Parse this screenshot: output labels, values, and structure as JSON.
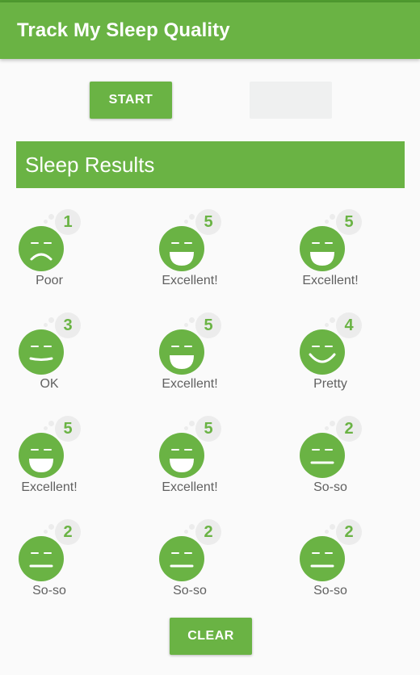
{
  "app": {
    "title": "Track My Sleep Quality"
  },
  "controls": {
    "start_label": "START",
    "stop_label": "",
    "clear_label": "CLEAR"
  },
  "results": {
    "title": "Sleep Results",
    "items": [
      {
        "rating": "1",
        "label": "Poor",
        "face": "sad"
      },
      {
        "rating": "5",
        "label": "Excellent!",
        "face": "laugh"
      },
      {
        "rating": "5",
        "label": "Excellent!",
        "face": "laugh"
      },
      {
        "rating": "3",
        "label": "OK",
        "face": "ok"
      },
      {
        "rating": "5",
        "label": "Excellent!",
        "face": "laugh"
      },
      {
        "rating": "4",
        "label": "Pretty",
        "face": "smile"
      },
      {
        "rating": "5",
        "label": "Excellent!",
        "face": "laugh"
      },
      {
        "rating": "5",
        "label": "Excellent!",
        "face": "laugh"
      },
      {
        "rating": "2",
        "label": "So-so",
        "face": "neutral"
      },
      {
        "rating": "2",
        "label": "So-so",
        "face": "neutral"
      },
      {
        "rating": "2",
        "label": "So-so",
        "face": "neutral"
      },
      {
        "rating": "2",
        "label": "So-so",
        "face": "neutral"
      }
    ]
  },
  "colors": {
    "accent": "#6ab344",
    "badge_bg": "#ececec",
    "label_text": "#616161"
  }
}
